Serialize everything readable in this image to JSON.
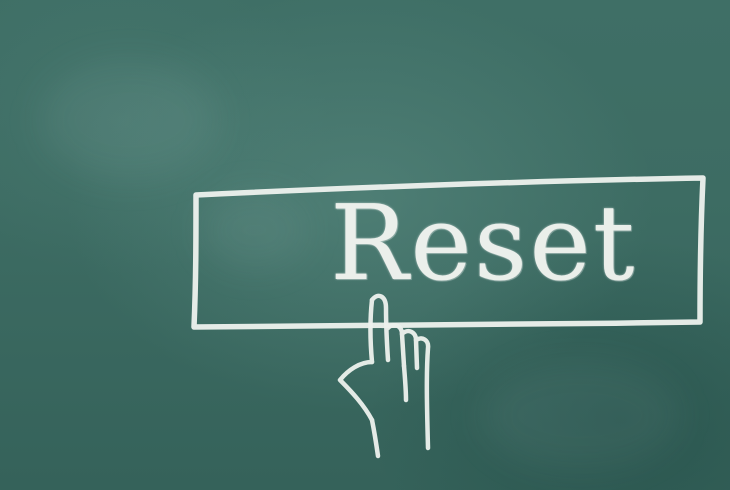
{
  "sign": {
    "label": "Reset"
  },
  "icons": {
    "pointer": "pointing-hand-icon"
  },
  "colors": {
    "board": "#3d6c63",
    "chalk": "#f4f6f2"
  }
}
